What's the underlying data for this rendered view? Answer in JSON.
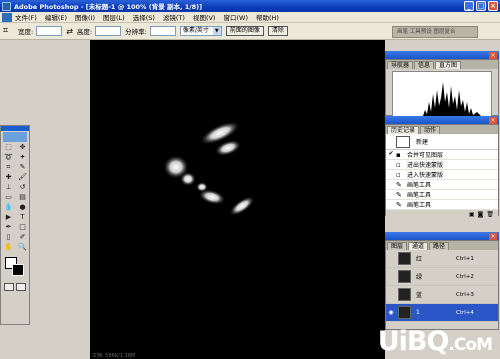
{
  "titlebar": {
    "title": "Adobe Photoshop - [未标题-1 @ 100% (背景 副本, 1/8)]"
  },
  "menu": {
    "items": [
      "文件(F)",
      "编辑(E)",
      "图像(I)",
      "图层(L)",
      "选择(S)",
      "滤镜(T)",
      "视图(V)",
      "窗口(W)",
      "帮助(H)"
    ]
  },
  "options": {
    "width_label": "宽度:",
    "height_label": "高度:",
    "resolution_label": "分辨率:",
    "unit_select": "像素/英寸",
    "front_image_button": "前面的图像",
    "clear_button": "清除",
    "palette_well": "画笔 工具预设 图层复合"
  },
  "navigator": {
    "tabs": [
      "导航器",
      "信息",
      "直方图"
    ],
    "active": 2
  },
  "history": {
    "tabs": [
      "历史记录",
      "动作"
    ],
    "snapshot": "新建",
    "items": [
      {
        "label": "合并可见图层",
        "checked": true
      },
      {
        "label": "进出快速蒙版",
        "checked": false
      },
      {
        "label": "进入快速蒙版",
        "checked": false
      },
      {
        "label": "画笔工具",
        "checked": false
      },
      {
        "label": "画笔工具",
        "checked": false
      },
      {
        "label": "画笔工具",
        "checked": false
      }
    ]
  },
  "channels": {
    "tabs": [
      "图层",
      "通道",
      "路径"
    ],
    "active_tab": 1,
    "rows": [
      {
        "name": "红",
        "shortcut": "Ctrl+1"
      },
      {
        "name": "绿",
        "shortcut": "Ctrl+2"
      },
      {
        "name": "蓝",
        "shortcut": "Ctrl+3"
      },
      {
        "name": "1",
        "shortcut": "Ctrl+4"
      }
    ]
  },
  "status": {
    "text": "文档: 586K/1.38M"
  },
  "watermark": {
    "text": "UiBQ.CoM"
  },
  "colors": {
    "accent": "#2b56c8",
    "titlebar": "#0a3cba",
    "canvas": "#000000"
  }
}
